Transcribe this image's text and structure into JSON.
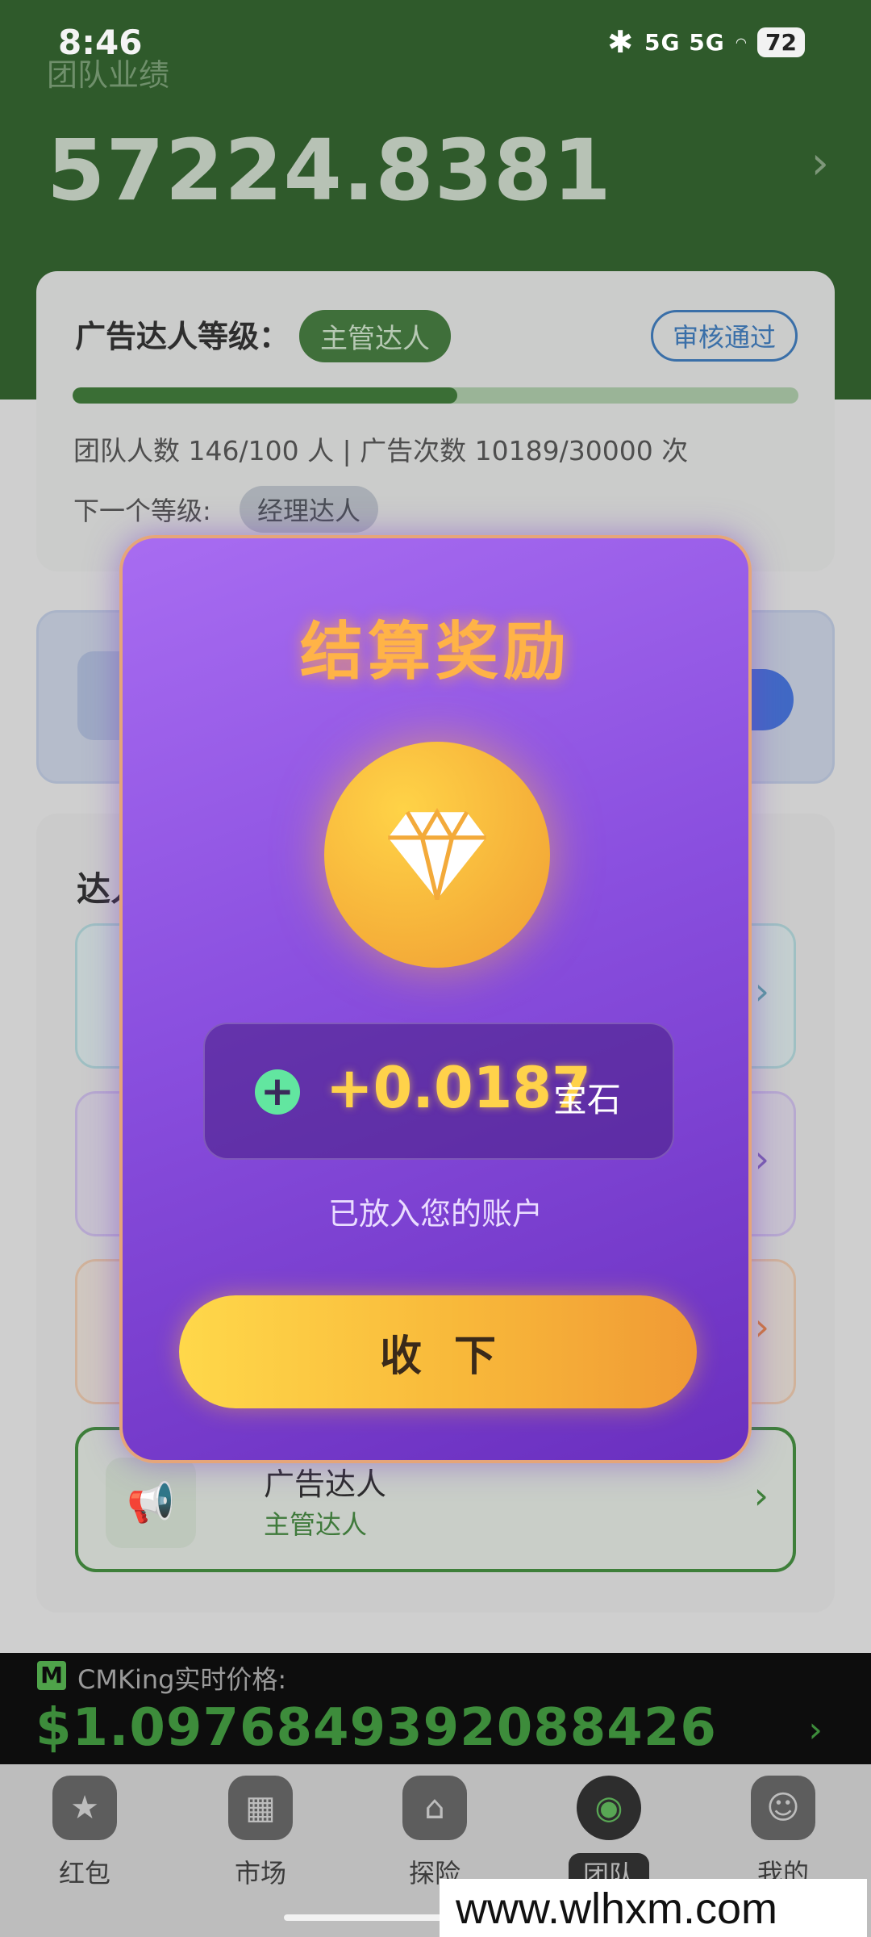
{
  "status_bar": {
    "time": "8:46",
    "battery": "72",
    "network": "5G 5G"
  },
  "header": {
    "label": "团队业绩",
    "value": "57224.8381"
  },
  "level_card": {
    "title": "广告达人等级：",
    "current_level": "主管达人",
    "review_status": "审核通过",
    "progress_fraction": 0.53,
    "stats": "团队人数 146/100 人 | 广告次数 10189/30000 次",
    "next_label": "下一个等级:",
    "next_level": "经理达人"
  },
  "list_card": {
    "title": "达人",
    "items": [
      {
        "name": "广告达人",
        "sub": "主管达人"
      }
    ]
  },
  "price_bar": {
    "badge": "M",
    "label": "CMKing实时价格:",
    "value": "$1.0976849392088426"
  },
  "tabs": [
    {
      "label": "红包",
      "icon": "star-badge-icon"
    },
    {
      "label": "市场",
      "icon": "calendar-icon"
    },
    {
      "label": "探险",
      "icon": "house-icon"
    },
    {
      "label": "团队",
      "icon": "team-aperture-icon",
      "active": true
    },
    {
      "label": "我的",
      "icon": "user-icon"
    }
  ],
  "modal": {
    "title": "结算奖励",
    "amount": "+0.0187",
    "unit": "宝石",
    "note": "已放入您的账户",
    "button": "收下"
  },
  "watermark": "www.wlhxm.com",
  "colors": {
    "modal_bg": "#8a4fdf",
    "gold": "#ffd24a",
    "accent_green": "#3d8c3b"
  }
}
